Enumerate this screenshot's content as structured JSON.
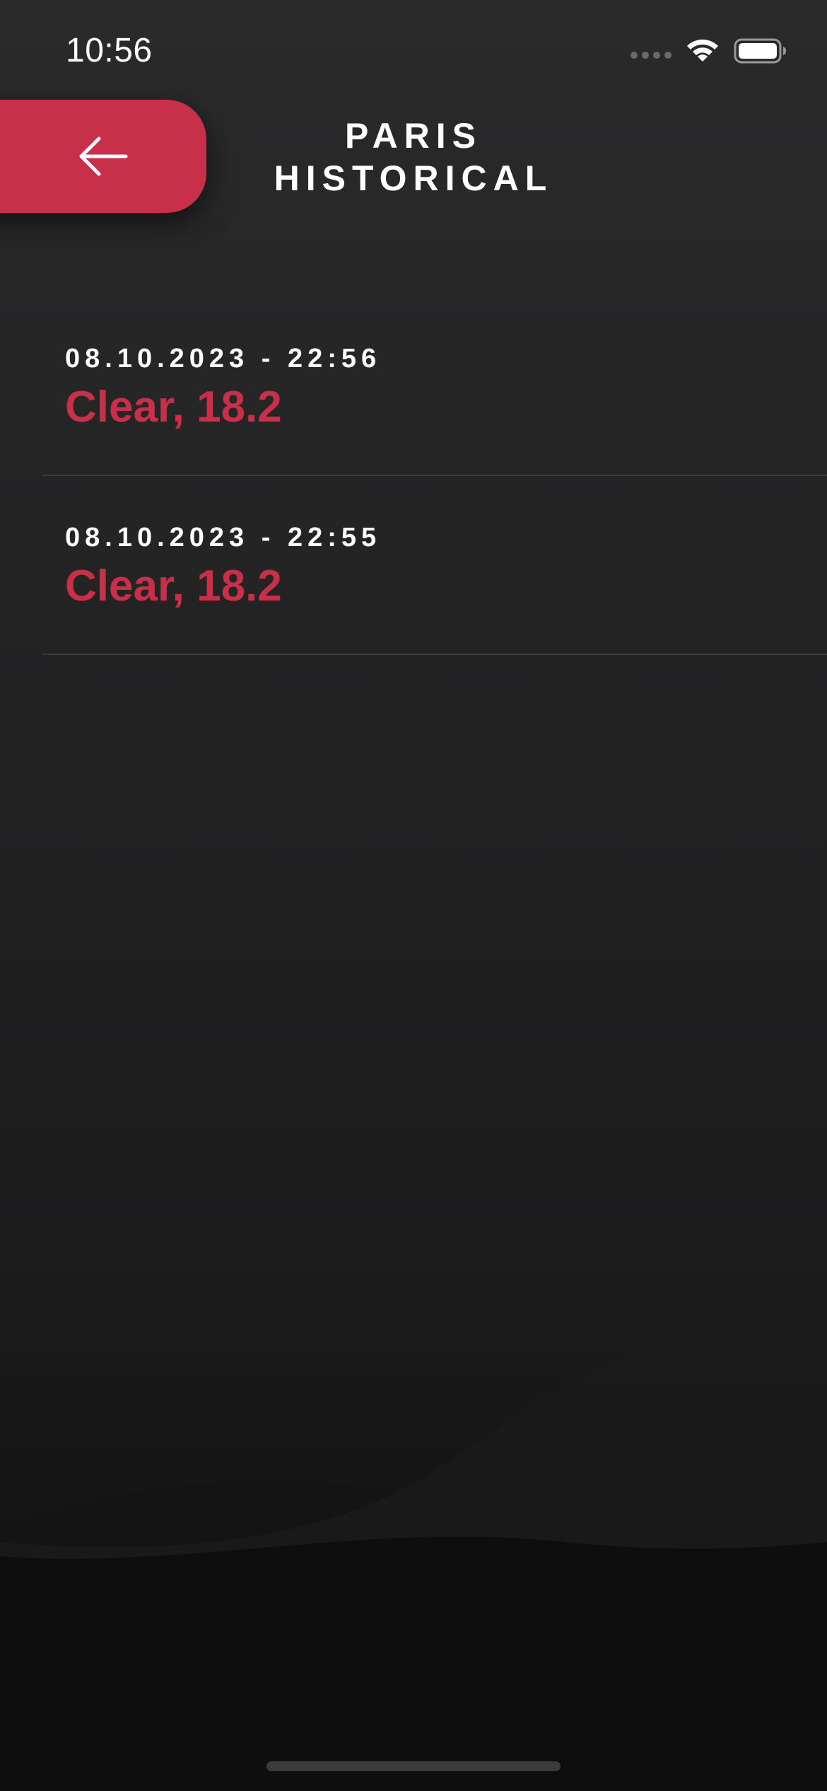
{
  "status_bar": {
    "time": "10:56",
    "icons": [
      "signal-dots-icon",
      "wifi-icon",
      "battery-icon"
    ]
  },
  "header": {
    "back_icon": "arrow-left-icon",
    "title": "PARIS\nHISTORICAL"
  },
  "history": {
    "items": [
      {
        "date": "08.10.2023 - 22:56",
        "weather": "Clear, 18.2"
      },
      {
        "date": "08.10.2023 - 22:55",
        "weather": "Clear, 18.2"
      }
    ]
  },
  "colors": {
    "accent": "#c8304a",
    "background": "#232324",
    "text": "#ffffff",
    "divider": "#3a3a3b"
  }
}
